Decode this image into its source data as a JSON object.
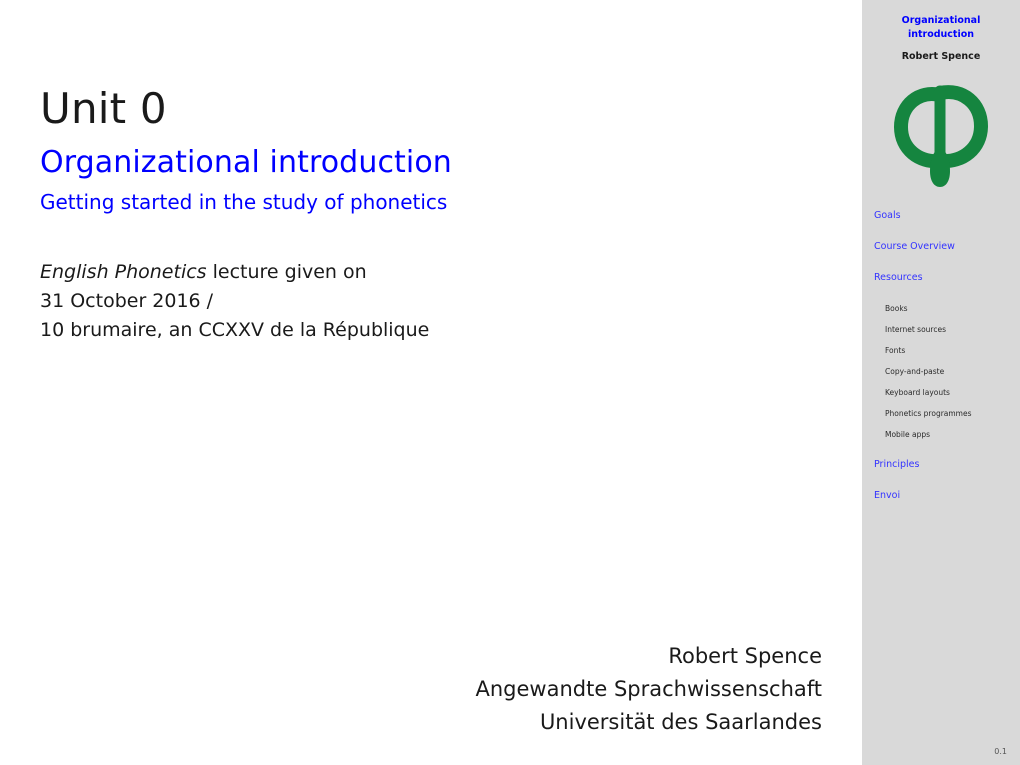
{
  "slide": {
    "unit_title": "Unit 0",
    "title": "Organizational introduction",
    "subtitle": "Getting started in the study of phonetics",
    "lecture": {
      "course_name": "English Phonetics",
      "given_on": " lecture given on",
      "date_line": "31 October 2016 /",
      "republican_date_line": "10 brumaire, an CCXXV de la République"
    },
    "author": {
      "name": "Robert Spence",
      "department": "Angewandte Sprachwissenschaft",
      "institution": "Universität des Saarlandes"
    },
    "page_number": "0.1"
  },
  "sidebar": {
    "header": {
      "title": "Organizational introduction",
      "author": "Robert Spence"
    },
    "logo": {
      "icon": "greek-phi-logo",
      "color": "#15853f"
    },
    "toc": [
      {
        "label": "Goals",
        "level": 1
      },
      {
        "label": "Course Overview",
        "level": 1
      },
      {
        "label": "Resources",
        "level": 1
      },
      {
        "label": "Books",
        "level": 2
      },
      {
        "label": "Internet sources",
        "level": 2
      },
      {
        "label": "Fonts",
        "level": 2
      },
      {
        "label": "Copy-and-paste",
        "level": 2
      },
      {
        "label": "Keyboard layouts",
        "level": 2
      },
      {
        "label": "Phonetics programmes",
        "level": 2
      },
      {
        "label": "Mobile apps",
        "level": 2
      },
      {
        "label": "Principles",
        "level": 1
      },
      {
        "label": "Envoi",
        "level": 1
      }
    ]
  },
  "colors": {
    "accent_blue": "#0000ff",
    "sidebar_bg": "#d9d9d9",
    "logo_green": "#15853f",
    "text_dark": "#1a1a1a"
  }
}
